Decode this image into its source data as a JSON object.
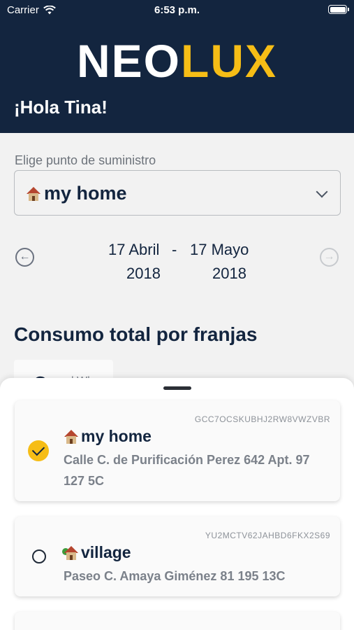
{
  "status_bar": {
    "carrier": "Carrier",
    "time": "6:53 p.m."
  },
  "header": {
    "logo_neo": "NEO",
    "logo_lux": "LUX",
    "greeting": "¡Hola Tina!"
  },
  "supply": {
    "label": "Elige punto de suministro",
    "selected": "my home",
    "selected_icon": "house-icon"
  },
  "dates": {
    "start_day_month": "17 Abril",
    "start_year": "2018",
    "separator": "-",
    "end_day_month": "17 Mayo",
    "end_year": "2018"
  },
  "section": {
    "title": "Consumo total por franjas",
    "chip_value": "C",
    "chip_unit": "kWh"
  },
  "sheet": {
    "cards": [
      {
        "id": "GCC7OCSKUBHJ2RW8VWZVBR",
        "name": "my home",
        "icon": "house-icon",
        "address": "Calle C. de Purificación Perez 642 Apt. 97  127 5C",
        "selected": true
      },
      {
        "id": "YU2MCTV62JAHBD6FKX2S69",
        "name": "village",
        "icon": "house-with-garden-icon",
        "address": "Paseo C. Amaya Giménez 81 195 13C",
        "selected": false
      }
    ]
  },
  "colors": {
    "navy": "#13253f",
    "accent": "#f6bd16"
  }
}
